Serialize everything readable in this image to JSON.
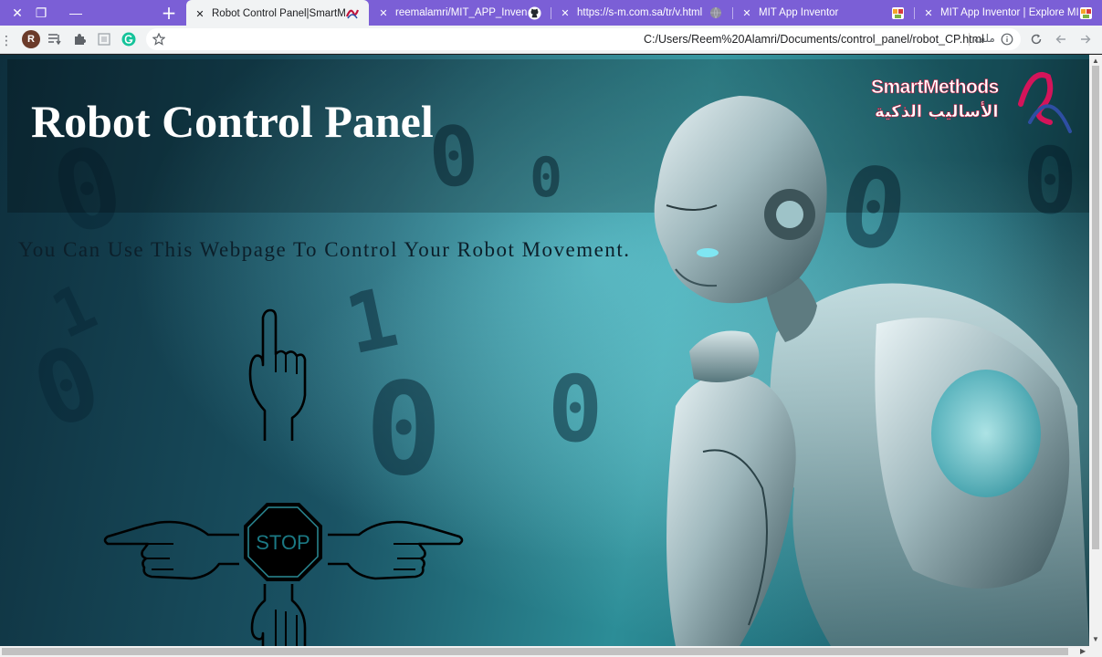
{
  "browser": {
    "tabs": [
      {
        "title": "Robot Control Panel|SmartMetho",
        "active": true,
        "favicon": "smartmethods-icon"
      },
      {
        "title": "reemalamri/MIT_APP_Inventor",
        "active": false,
        "favicon": "github-icon"
      },
      {
        "title": "https://s-m.com.sa/tr/v.html",
        "active": false,
        "favicon": "globe-icon"
      },
      {
        "title": "MIT App Inventor",
        "active": false,
        "favicon": "app-inventor-icon"
      },
      {
        "title": "MIT App Inventor | Explore MIT A",
        "active": false,
        "favicon": "app-inventor-icon"
      }
    ],
    "profile_initial": "R",
    "url": "C:/Users/Reem%20Alamri/Documents/control_panel/robot_CP.html",
    "scheme_label": "ملف",
    "accent": "#7b5fd6"
  },
  "page": {
    "title": "Robot Control Panel",
    "subtitle": "You Can Use This Webpage To Control Your Robot Movement.",
    "logo": {
      "en": "SmartMethods",
      "ar": "الأساليب الذكية"
    },
    "controls": {
      "stop_label": "STOP",
      "directions": [
        "forward",
        "left",
        "right",
        "backward"
      ]
    }
  }
}
